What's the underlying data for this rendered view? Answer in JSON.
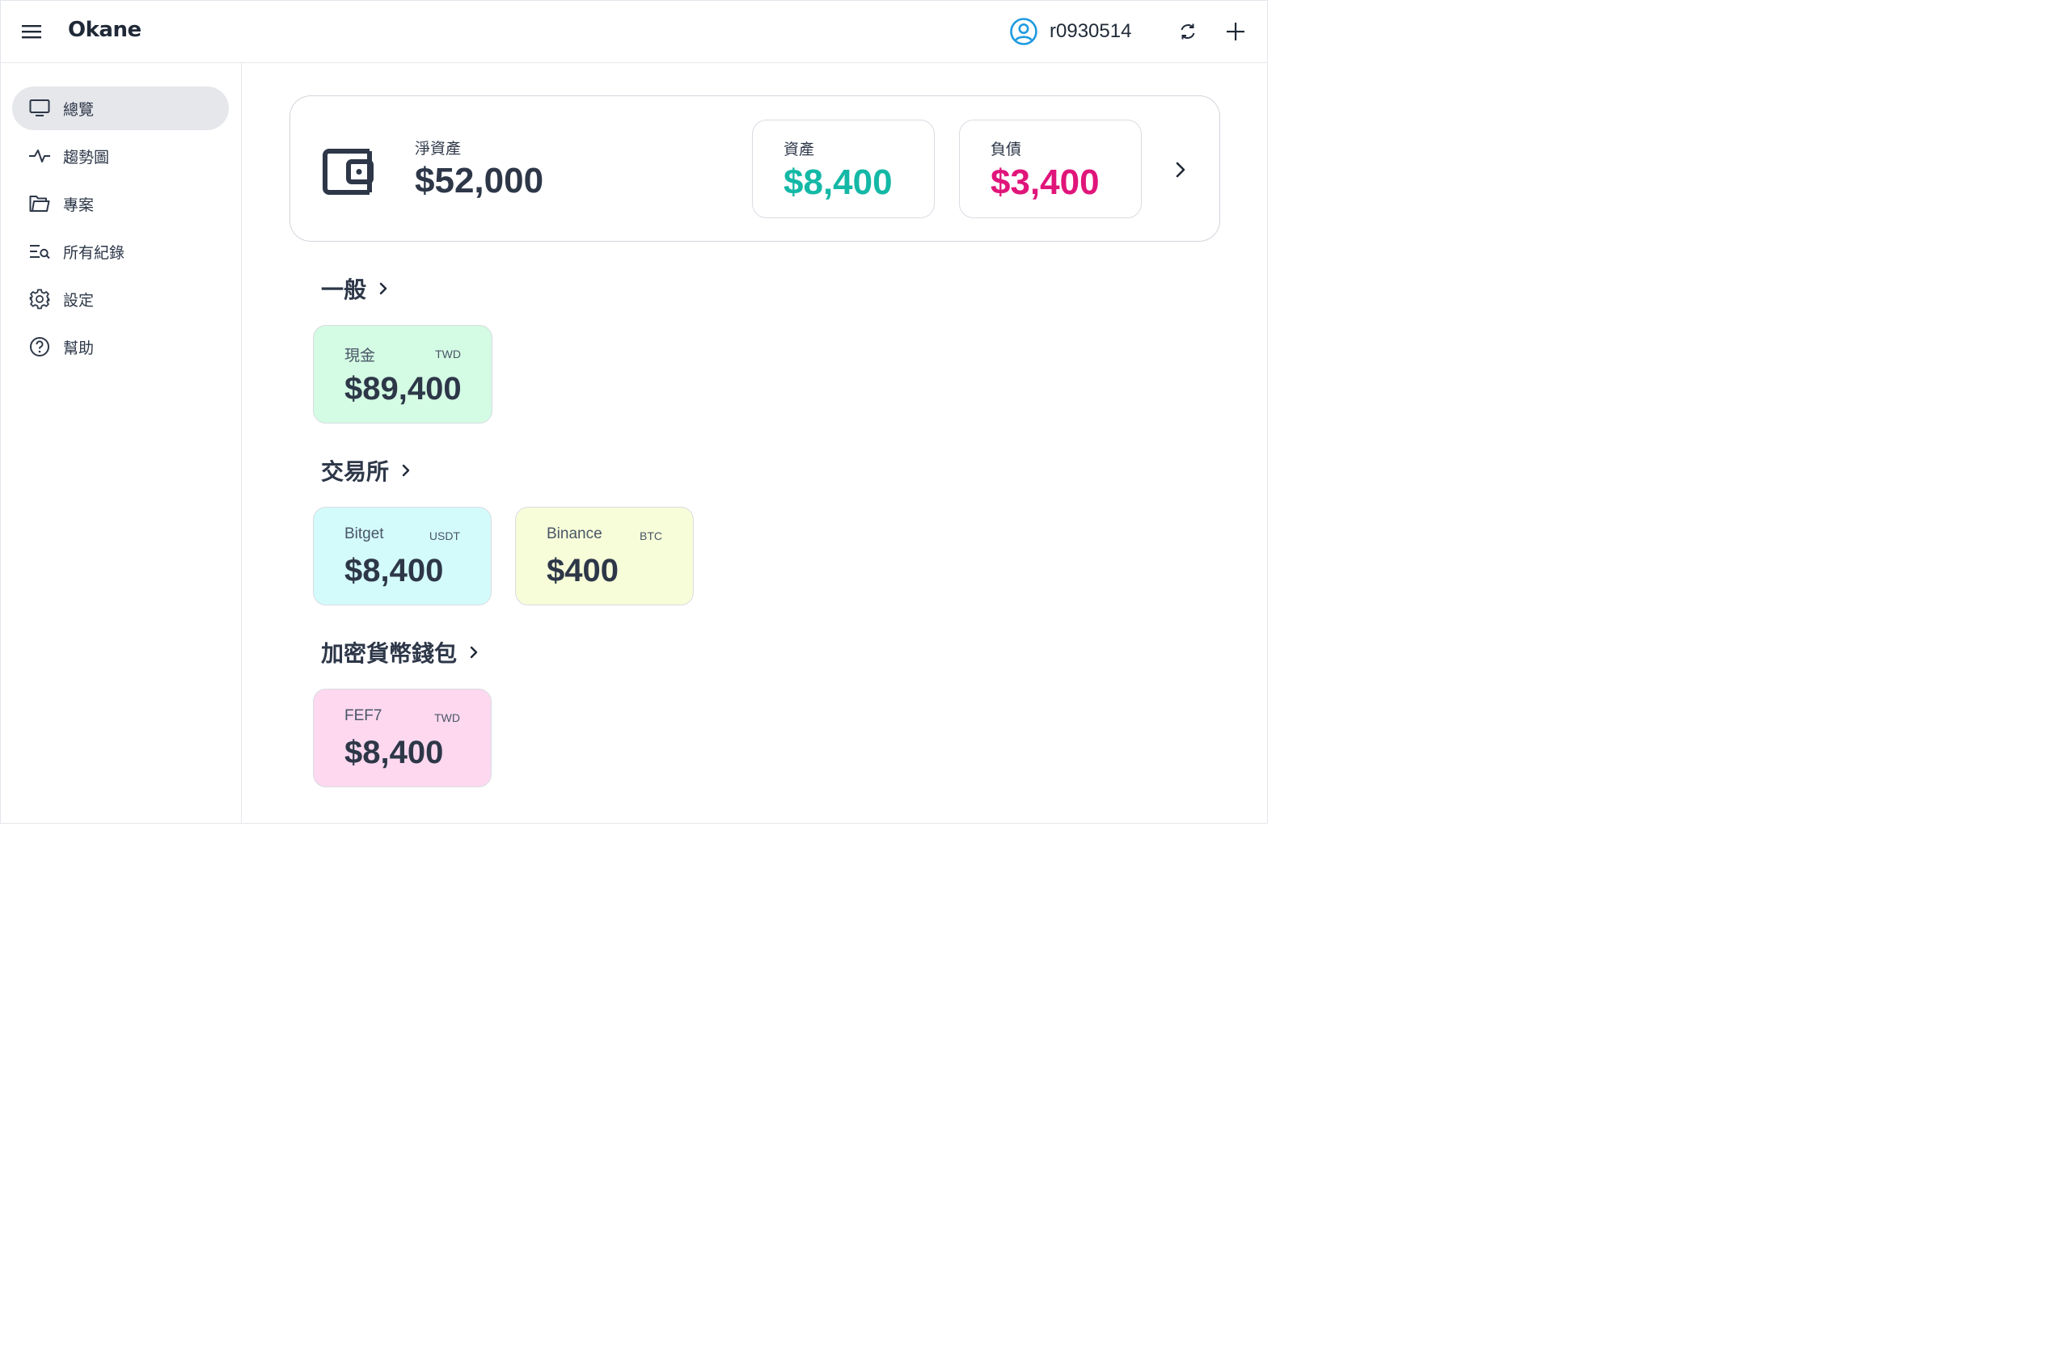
{
  "app": {
    "title": "Okane"
  },
  "header": {
    "username": "r0930514"
  },
  "sidebar": {
    "items": [
      {
        "label": "總覽",
        "icon": "monitor-icon",
        "active": true
      },
      {
        "label": "趨勢圖",
        "icon": "trend-line-icon"
      },
      {
        "label": "專案",
        "icon": "folder-icon"
      },
      {
        "label": "所有紀錄",
        "icon": "list-search-icon"
      },
      {
        "label": "設定",
        "icon": "gear-icon"
      },
      {
        "label": "幫助",
        "icon": "help-circle-icon"
      }
    ]
  },
  "summary": {
    "net_label": "淨資產",
    "net_value": "$52,000",
    "assets_label": "資產",
    "assets_value": "$8,400",
    "liabilities_label": "負債",
    "liabilities_value": "$3,400"
  },
  "sections": [
    {
      "title": "一般",
      "accounts": [
        {
          "name": "現金",
          "currency": "TWD",
          "value": "$89,400",
          "color": "#d4fbe3"
        }
      ]
    },
    {
      "title": "交易所",
      "accounts": [
        {
          "name": "Bitget",
          "currency": "USDT",
          "value": "$8,400",
          "color": "#d3fbfb"
        },
        {
          "name": "Binance",
          "currency": "BTC",
          "value": "$400",
          "color": "#f6fdd8"
        }
      ]
    },
    {
      "title": "加密貨幣錢包",
      "accounts": [
        {
          "name": "FEF7",
          "currency": "TWD",
          "value": "$8,400",
          "color": "#fdd8ef"
        }
      ]
    }
  ],
  "colors": {
    "assets": "#14b8a6",
    "liabilities": "#e0157a",
    "text": "#2d3748",
    "user_icon": "#1e9be0"
  }
}
